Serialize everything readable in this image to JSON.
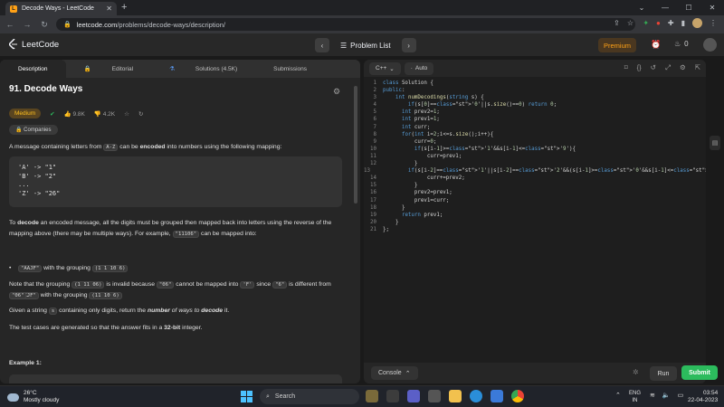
{
  "browser": {
    "tab_title": "Decode Ways - LeetCode",
    "url_host": "leetcode.com",
    "url_path": "/problems/decode-ways/description/"
  },
  "header": {
    "logo_text": "LeetCode",
    "problem_list_label": "Problem List",
    "premium_label": "Premium",
    "coin_count": "0"
  },
  "left_tabs": [
    {
      "label": "Description"
    },
    {
      "label": "Editorial"
    },
    {
      "label": "Solutions (4.5K)"
    },
    {
      "label": "Submissions"
    }
  ],
  "problem": {
    "title": "91. Decode Ways",
    "difficulty": "Medium",
    "likes": "9.8K",
    "dislikes": "4.2K",
    "companies_label": "Companies",
    "p1_a": "A message containing letters from ",
    "p1_code": "A-Z",
    "p1_b": " can be ",
    "p1_bold": "encoded",
    "p1_c": " into numbers using the following mapping:",
    "mapping": [
      "'A' -> \"1\"",
      "'B' -> \"2\"",
      "...",
      "'Z' -> \"26\""
    ],
    "p2_bold": "decode",
    "p2_a": "To ",
    "p2_b": " an encoded message, all the digits must be grouped then mapped back into letters using the reverse of the mapping above (there may be multiple ways). For example, ",
    "p2_code": "\"11106\"",
    "p2_c": " can be mapped into:",
    "bullet1_code": "\"AAJF\"",
    "bullet1_text": " with the grouping ",
    "bullet1_group": "(1 1 10 6)",
    "bullet2_code": "\"KJF\"",
    "bullet2_text": " with the grouping ",
    "bullet2_group": "(11 10 6)",
    "p3_a": "Note that the grouping ",
    "p3_code1": "(1 11 06)",
    "p3_b": " is invalid because ",
    "p3_code2": "\"06\"",
    "p3_c": " cannot be mapped into ",
    "p3_code3": "'F'",
    "p3_d": " since ",
    "p3_code4": "\"6\"",
    "p3_e": " is different from ",
    "p3_code5": "\"06\"",
    "p3_f": ".",
    "p4_a": "Given a string ",
    "p4_code": "s",
    "p4_b": " containing only digits, return the ",
    "p4_em": "number",
    "p4_c": " of ways to ",
    "p4_em2": "decode",
    "p4_d": " it.",
    "p5_a": "The test cases are generated so that the answer fits in a ",
    "p5_bold": "32-bit",
    "p5_b": " integer.",
    "example_heading": "Example 1:"
  },
  "editor": {
    "language": "C++",
    "mode": "Auto",
    "lines": [
      "class Solution {",
      "public:",
      "    int numDecodings(string s) {",
      "        if(s[0]=='0'||s.size()==0) return 0;",
      "      int prev2=1;",
      "      int prev1=1;",
      "      int curr;",
      "      for(int i=2;i<=s.size();i++){",
      "          curr=0;",
      "          if(s[i-1]>='1'&&s[i-1]<='9'){",
      "              curr=prev1;",
      "          }",
      "          if(s[i-2]=='1'||s[i-2]=='2'&&(s[i-1]>='0'&&s[i-1]<='6')){",
      "              curr+=prev2;",
      "          }",
      "          prev2=prev1;",
      "          prev1=curr;",
      "      }",
      "      return prev1;",
      "    }",
      "};"
    ],
    "console_label": "Console",
    "run_label": "Run",
    "submit_label": "Submit"
  },
  "taskbar": {
    "temp": "26°C",
    "weather": "Mostly cloudy",
    "search_label": "Search",
    "lang_top": "ENG",
    "lang_bottom": "IN",
    "time": "03:54",
    "date": "22-04-2023"
  }
}
